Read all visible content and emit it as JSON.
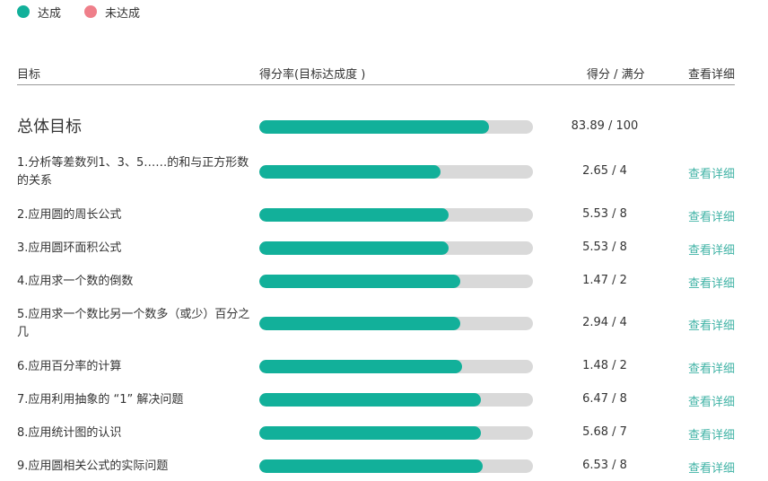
{
  "legend": {
    "achieved": "达成",
    "unachieved": "未达成"
  },
  "colors": {
    "achieved": "#12b09a",
    "unachieved": "#ef7f8a",
    "track": "#d9d9d9",
    "link": "#41b3a6"
  },
  "header": {
    "goal": "目标",
    "rate": "得分率(目标达成度 )",
    "score": "得分 / 满分",
    "detail": "查看详细"
  },
  "rows": [
    {
      "goal": "总体目标",
      "score": "83.89 / 100",
      "rate": 0.8389,
      "detail": ""
    },
    {
      "goal": "1.分析等差数列1、3、5……的和与正方形数的关系",
      "score": "2.65 / 4",
      "rate": 0.6625,
      "detail": "查看详细"
    },
    {
      "goal": "2.应用圆的周长公式",
      "score": "5.53 / 8",
      "rate": 0.6913,
      "detail": "查看详细"
    },
    {
      "goal": "3.应用圆环面积公式",
      "score": "5.53 / 8",
      "rate": 0.6913,
      "detail": "查看详细"
    },
    {
      "goal": "4.应用求一个数的倒数",
      "score": "1.47 / 2",
      "rate": 0.735,
      "detail": "查看详细"
    },
    {
      "goal": "5.应用求一个数比另一个数多（或少）百分之几",
      "score": "2.94 / 4",
      "rate": 0.735,
      "detail": "查看详细"
    },
    {
      "goal": "6.应用百分率的计算",
      "score": "1.48 / 2",
      "rate": 0.74,
      "detail": "查看详细"
    },
    {
      "goal": "7.应用利用抽象的 “1” 解决问题",
      "score": "6.47 / 8",
      "rate": 0.8088,
      "detail": "查看详细"
    },
    {
      "goal": "8.应用统计图的认识",
      "score": "5.68 / 7",
      "rate": 0.8114,
      "detail": "查看详细"
    },
    {
      "goal": "9.应用圆相关公式的实际问题",
      "score": "6.53 / 8",
      "rate": 0.8163,
      "detail": "查看详细"
    }
  ]
}
